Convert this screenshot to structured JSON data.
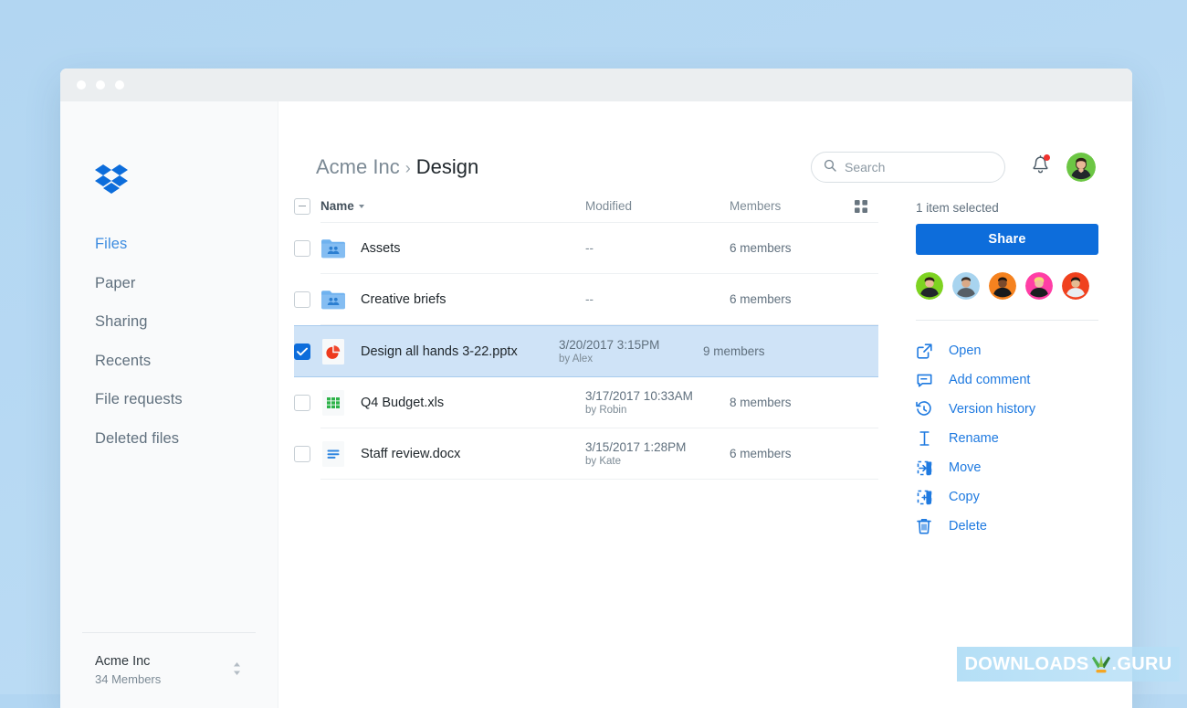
{
  "window": {
    "traffic_lights": [
      "close",
      "minimize",
      "maximize"
    ]
  },
  "sidebar": {
    "logo": "dropbox-logo",
    "items": [
      {
        "label": "Files",
        "active": true
      },
      {
        "label": "Paper",
        "active": false
      },
      {
        "label": "Sharing",
        "active": false
      },
      {
        "label": "Recents",
        "active": false
      },
      {
        "label": "File requests",
        "active": false
      },
      {
        "label": "Deleted files",
        "active": false
      }
    ],
    "team": {
      "name": "Acme Inc",
      "members": "34 Members",
      "switcher_icon": "chevron-up-down-icon"
    }
  },
  "header": {
    "breadcrumb": {
      "parent": "Acme Inc",
      "separator": "›",
      "current": "Design"
    },
    "search": {
      "placeholder": "Search",
      "value": "",
      "icon": "search-icon"
    },
    "notifications": {
      "icon": "bell-icon",
      "has_badge": true
    },
    "avatar": "user-avatar"
  },
  "table": {
    "select_all_state": "indeterminate",
    "columns": {
      "name": "Name",
      "modified": "Modified",
      "members": "Members"
    },
    "sort": {
      "column": "Name",
      "direction": "desc",
      "icon": "caret-down-icon"
    },
    "view_toggle_icon": "grid-view-icon",
    "rows": [
      {
        "name": "Assets",
        "icon": "shared-folder-icon",
        "modified": "--",
        "modified_by": "",
        "members": "6 members",
        "selected": false
      },
      {
        "name": "Creative briefs",
        "icon": "shared-folder-icon",
        "modified": "--",
        "modified_by": "",
        "members": "6 members",
        "selected": false
      },
      {
        "name": "Design all hands 3-22.pptx",
        "icon": "powerpoint-file-icon",
        "modified": "3/20/2017 3:15PM",
        "modified_by": "by Alex",
        "members": "9 members",
        "selected": true
      },
      {
        "name": "Q4 Budget.xls",
        "icon": "excel-file-icon",
        "modified": "3/17/2017 10:33AM",
        "modified_by": "by Robin",
        "members": "8 members",
        "selected": false
      },
      {
        "name": "Staff review.docx",
        "icon": "word-file-icon",
        "modified": "3/15/2017 1:28PM",
        "modified_by": "by Kate",
        "members": "6 members",
        "selected": false
      }
    ]
  },
  "panel": {
    "selection_label": "1 item selected",
    "share_button": "Share",
    "member_avatars": [
      {
        "name": "member-avatar-1",
        "bg": "#7ed321"
      },
      {
        "name": "member-avatar-2",
        "bg": "#a8d4ef"
      },
      {
        "name": "member-avatar-3",
        "bg": "#f5821f"
      },
      {
        "name": "member-avatar-4",
        "bg": "#ff3ea5"
      },
      {
        "name": "member-avatar-5",
        "bg": "#f0411e"
      }
    ],
    "actions": [
      {
        "label": "Open",
        "icon": "open-external-icon"
      },
      {
        "label": "Add comment",
        "icon": "comment-icon"
      },
      {
        "label": "Version history",
        "icon": "history-clock-icon"
      },
      {
        "label": "Rename",
        "icon": "text-cursor-icon"
      },
      {
        "label": "Move",
        "icon": "move-arrow-icon"
      },
      {
        "label": "Copy",
        "icon": "copy-plus-icon"
      },
      {
        "label": "Delete",
        "icon": "trash-icon"
      }
    ]
  },
  "watermark": {
    "text_left": "DOWNLOADS",
    "text_right": ".GURU",
    "logo": "downloads-guru-logo"
  },
  "colors": {
    "accent": "#0d6ddb",
    "link": "#1f7ae0",
    "selected_row": "#cfe3f7",
    "page_background": "#b2d6f2",
    "badge": "#f0322e"
  }
}
